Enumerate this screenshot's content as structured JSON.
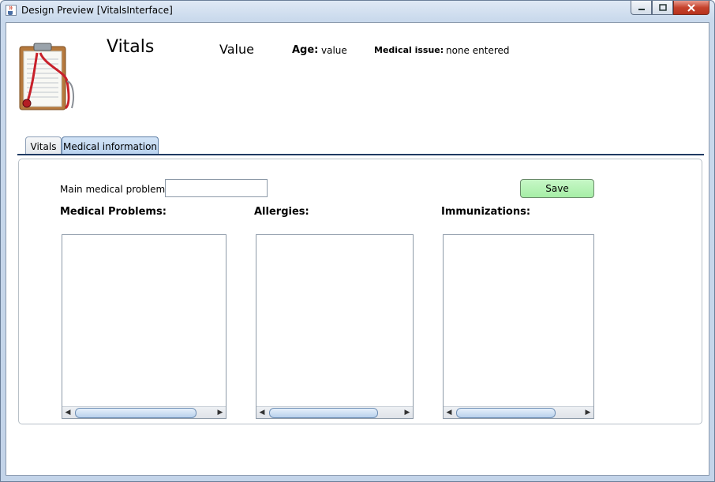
{
  "window": {
    "title": "Design Preview [VitalsInterface]",
    "icon": "java-cup-icon"
  },
  "header": {
    "title": "Vitals",
    "value_label": "Value",
    "age_label": "Age:",
    "age_value": "value",
    "issue_label": "Medical issue:",
    "issue_value": "none entered",
    "logo_icon": "clipboard-stethoscope-icon"
  },
  "tabs": [
    {
      "label": "Vitals",
      "selected": false
    },
    {
      "label": "Medical information",
      "selected": true
    }
  ],
  "form": {
    "main_problem_label": "Main medical problem:",
    "main_problem_value": "",
    "save_label": "Save",
    "save_color": "#b6f2b6"
  },
  "lists": {
    "medical_problems_title": "Medical Problems:",
    "allergies_title": "Allergies:",
    "immunizations_title": "Immunizations:"
  }
}
